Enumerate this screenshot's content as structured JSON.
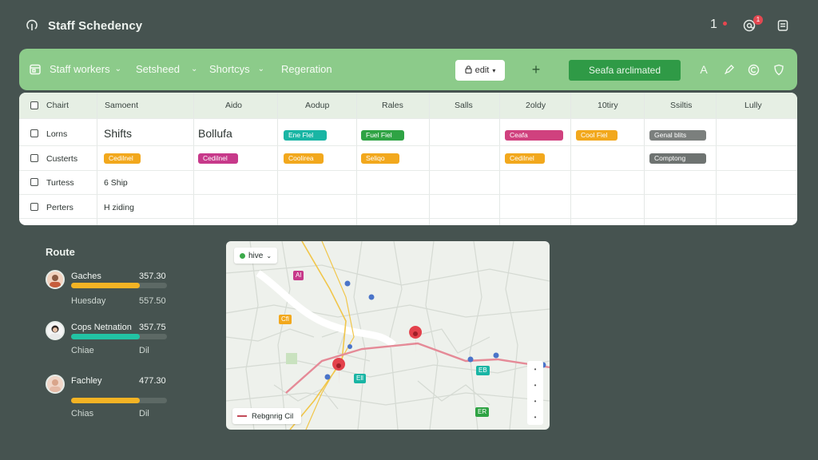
{
  "app": {
    "title": "Staff Schedency",
    "notification_count": "1",
    "badge_count": "1"
  },
  "toolbar": {
    "menus": [
      {
        "label": "Staff workers",
        "has_chevron": true
      },
      {
        "label": "Setsheed",
        "has_chevron": true
      },
      {
        "label": "Shortcys",
        "has_chevron": true
      },
      {
        "label": "Regeration",
        "has_chevron": false
      }
    ],
    "edit_label": "edit",
    "plus_label": "+",
    "primary_label": "Seafa arclimated",
    "right_icons": [
      "A",
      "pen-icon",
      "c-circle-icon",
      "shield-icon"
    ],
    "accent_color": "#2f9a46"
  },
  "table": {
    "headers": [
      "Chairt",
      "Samoent",
      "Aido",
      "Aodup",
      "Rales",
      "Salls",
      "2oldy",
      "10tiry",
      "Ssiltis",
      "Lully"
    ],
    "rows": [
      {
        "label": "Lorns",
        "text_cells": {
          "1": "Shifts",
          "2": "Bollufa"
        },
        "pills": [
          {
            "col": 3,
            "text": "Ene Flel",
            "color": "#19b5a4"
          },
          {
            "col": 4,
            "text": "Fuel Fiel",
            "color": "#2fa344"
          },
          {
            "col": 6,
            "text": "Ceafa",
            "color": "#d0417e"
          },
          {
            "col": 7,
            "text": "Cool Fiel",
            "color": "#f2a81d"
          },
          {
            "col": 8,
            "text": "Genal blits",
            "color": "#7b7f7d"
          }
        ]
      },
      {
        "label": "Custerts",
        "text_cells": {},
        "pills": [
          {
            "col": 1,
            "text": "Cedilnel",
            "color": "#f2a81d"
          },
          {
            "col": 2,
            "text": "Cedilnel",
            "color": "#c7398a"
          },
          {
            "col": 3,
            "text": "Coolirea",
            "color": "#f2a81d"
          },
          {
            "col": 4,
            "text": "Seliqo",
            "color": "#f2a81d"
          },
          {
            "col": 6,
            "text": "Cedilnel",
            "color": "#f2a81d"
          },
          {
            "col": 8,
            "text": "Comptong",
            "color": "#6e7371"
          }
        ]
      },
      {
        "label": "Turtess",
        "text_cells": {
          "1": "6 Ship"
        },
        "pills": []
      },
      {
        "label": "Perters",
        "text_cells": {
          "1": "H ziding"
        },
        "pills": []
      }
    ]
  },
  "route": {
    "title": "Route",
    "people": [
      {
        "name": "Gaches",
        "value": "357.30",
        "progress": 0.72,
        "color": "#f4b324",
        "sub_left": "Huesday",
        "sub_right": "557.50"
      },
      {
        "name": "Cops Netnation",
        "value": "357.75",
        "progress": 0.72,
        "color": "#22c3a4",
        "sub_left": "Chiae",
        "sub_right": "Dil"
      },
      {
        "name": "Fachley",
        "value": "477.30",
        "progress": 0.72,
        "color": "#f4b324",
        "sub_left": "Chias",
        "sub_right": "Dil"
      }
    ]
  },
  "map": {
    "chip_label": "hive",
    "tags": [
      {
        "text": "Al",
        "color": "#c7398a"
      },
      {
        "text": "Cfl",
        "color": "#f2a81d"
      },
      {
        "text": "Ell",
        "color": "#19b5a4"
      },
      {
        "text": "EB",
        "color": "#19b5a4"
      },
      {
        "text": "ER",
        "color": "#2fa344"
      }
    ],
    "legend_label": "Rebgnrig Cil",
    "route_color": "#e58a97",
    "pin_color": "#e3414b"
  }
}
